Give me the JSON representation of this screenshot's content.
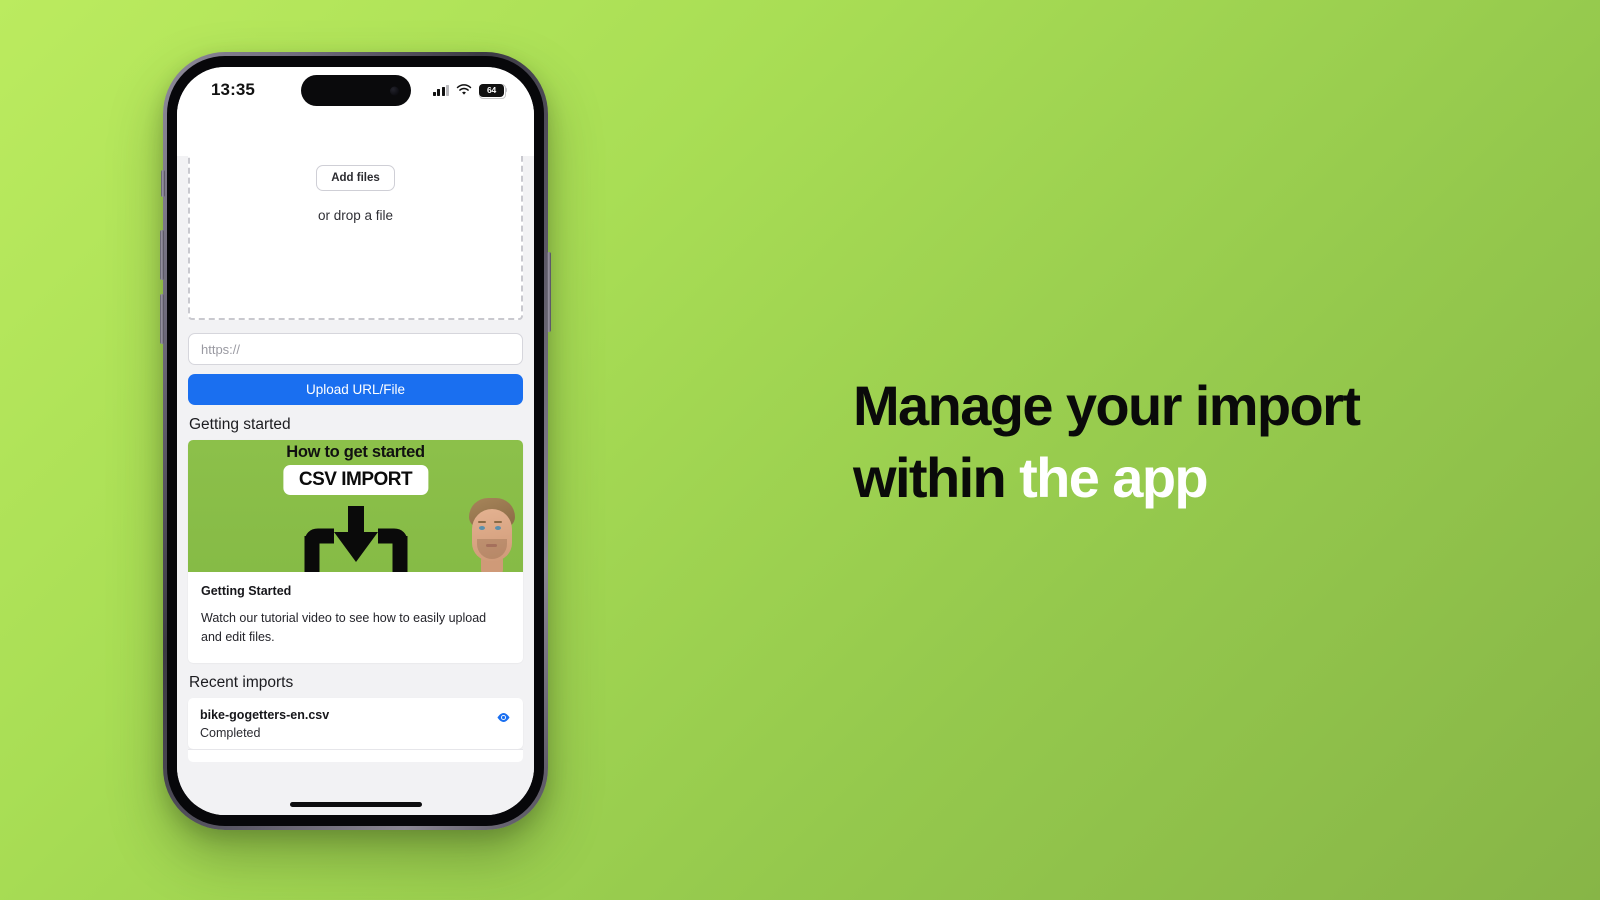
{
  "background": {
    "gradient_from": "#bbeb5f",
    "gradient_to": "#87b547"
  },
  "headline": {
    "line1": "Manage your import",
    "line2_prefix": "within ",
    "line2_accent": "the app",
    "color": "#0a0a0a",
    "accent_color": "#ffffff"
  },
  "phone": {
    "status_bar": {
      "time": "13:35",
      "cellular_icon": "cellular-bars-icon",
      "wifi_icon": "wifi-icon",
      "battery_icon": "battery-icon",
      "battery_percent": "64"
    },
    "home_indicator": "home-indicator"
  },
  "app": {
    "dropzone": {
      "add_files_label": "Add files",
      "drop_hint": "or drop a file"
    },
    "url_field": {
      "placeholder": "https://",
      "value": ""
    },
    "upload_button": {
      "label": "Upload URL/File",
      "color": "#1a6ff0"
    },
    "getting_started": {
      "section_title": "Getting started",
      "thumbnail": {
        "top_text": "How to get started",
        "pill_text": "CSV IMPORT",
        "arrow_icon": "download-arrow-icon",
        "presenter_icon": "presenter-face-icon",
        "background_color": "#8cc04a"
      },
      "card_title": "Getting Started",
      "card_text": "Watch our tutorial video to see how to easily upload and edit files."
    },
    "recent_imports": {
      "section_title": "Recent imports",
      "items": [
        {
          "filename": "bike-gogetters-en.csv",
          "status": "Completed",
          "action_icon": "eye-icon",
          "action_color": "#1a6ff0"
        }
      ]
    }
  }
}
